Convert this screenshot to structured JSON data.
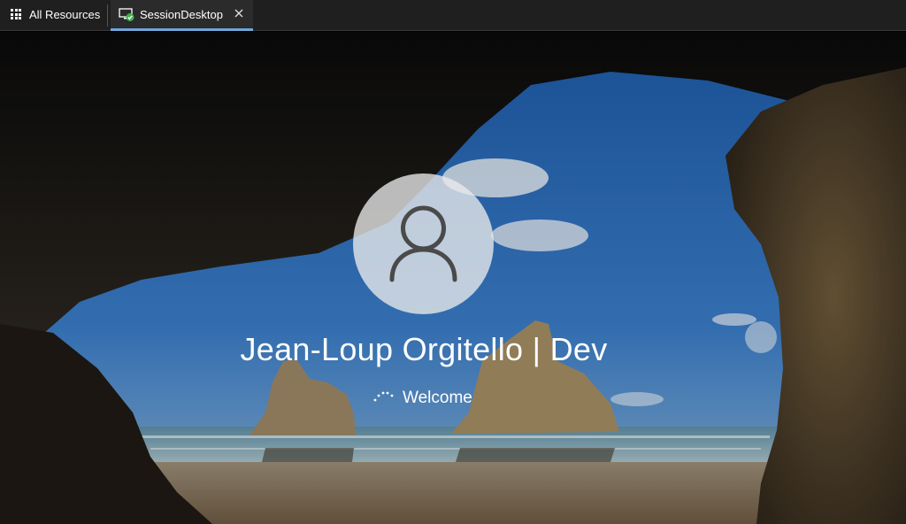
{
  "tabs": {
    "all_resources": {
      "label": "All Resources",
      "icon": "grid-icon"
    },
    "session": {
      "label": "SessionDesktop",
      "icon": "monitor-check-icon",
      "close_icon": "close-icon",
      "active": true
    }
  },
  "login": {
    "username": "Jean-Loup Orgitello | Dev",
    "status": "Welcome",
    "avatar_icon": "user-icon"
  },
  "colors": {
    "tabbar_bg": "#1f1f1f",
    "active_tab_bg": "#2b2b2b",
    "active_tab_accent": "#6ea6d8",
    "status_ok": "#3fb34f"
  }
}
